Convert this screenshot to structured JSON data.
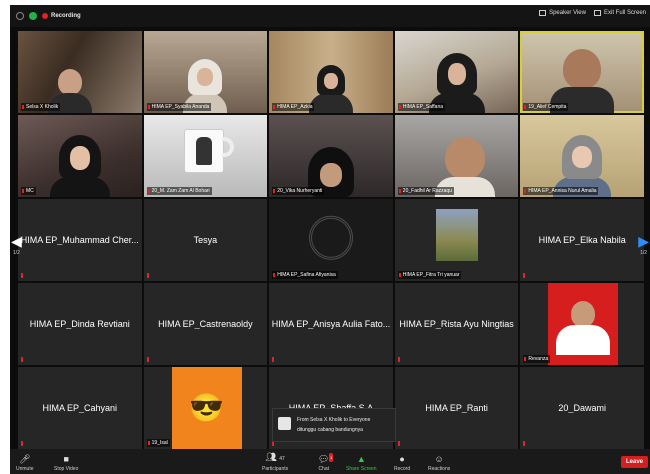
{
  "topbar": {
    "recording_label": "Recording",
    "speaker_view_label": "Speaker View",
    "exit_fullscreen_label": "Exit Full Screen"
  },
  "tiles": [
    {
      "name": "Selsa X Kholik",
      "type": "video"
    },
    {
      "name": "HIMA EP_Syabila Ananda",
      "type": "video"
    },
    {
      "name": "HIMA EP_Azkia",
      "type": "video"
    },
    {
      "name": "HIMA EP_Saffana",
      "type": "video"
    },
    {
      "name": "19_Alief Cempita",
      "type": "video",
      "highlighted": true
    },
    {
      "name": "MC",
      "type": "video"
    },
    {
      "name": "20_M. Zam Zam Al Bohari",
      "type": "video"
    },
    {
      "name": "20_Vika Nurheryanti",
      "type": "video"
    },
    {
      "name": "20_Fadhil Ar Razzaqu",
      "type": "video"
    },
    {
      "name": "HIMA EP_Annisa Nurul Amalia",
      "type": "video"
    },
    {
      "display": "HIMA EP_Muhammad Cher...",
      "type": "text"
    },
    {
      "display": "Tesya",
      "type": "text"
    },
    {
      "name": "HIMA EP_Safina Afiyanisa",
      "type": "logo"
    },
    {
      "name": "HIMA EP_Fitra Tri yanuar",
      "type": "thumb"
    },
    {
      "display": "HIMA EP_Elka Nabila",
      "type": "text"
    },
    {
      "display": "HIMA EP_Dinda Revtiani",
      "type": "text"
    },
    {
      "display": "HIMA EP_Castrenaoldy",
      "type": "text"
    },
    {
      "display": "HIMA EP_Anisya Aulia Fato...",
      "type": "text"
    },
    {
      "display": "HIMA EP_Rista Ayu Ningtias",
      "type": "text"
    },
    {
      "name": "Revanza",
      "type": "redphoto"
    },
    {
      "display": "HIMA EP_Cahyani",
      "type": "text"
    },
    {
      "name": "19_Isal",
      "type": "avatar"
    },
    {
      "display": "HIMA EP_Shaffa S.A",
      "type": "text"
    },
    {
      "display": "HIMA EP_Ranti",
      "type": "text"
    },
    {
      "display": "20_Dawami",
      "type": "text"
    }
  ],
  "pager": {
    "left": "1/2",
    "right": "1/2"
  },
  "chat_popup": {
    "from": "From Selsa X Kholik to Everyone",
    "message": "ditunggu cabang bandungnya"
  },
  "toolbar": {
    "unmute": "Unmute",
    "stop_video": "Stop Video",
    "participants": "Participants",
    "participants_count": "47",
    "chat": "Chat",
    "share_screen": "Share Screen",
    "record": "Record",
    "reactions": "Reactions",
    "leave": "Leave"
  },
  "colors": {
    "share": "#2ecc40",
    "leave": "#d41f1f",
    "highlight": "#d8d030",
    "recording": "#e02424"
  }
}
